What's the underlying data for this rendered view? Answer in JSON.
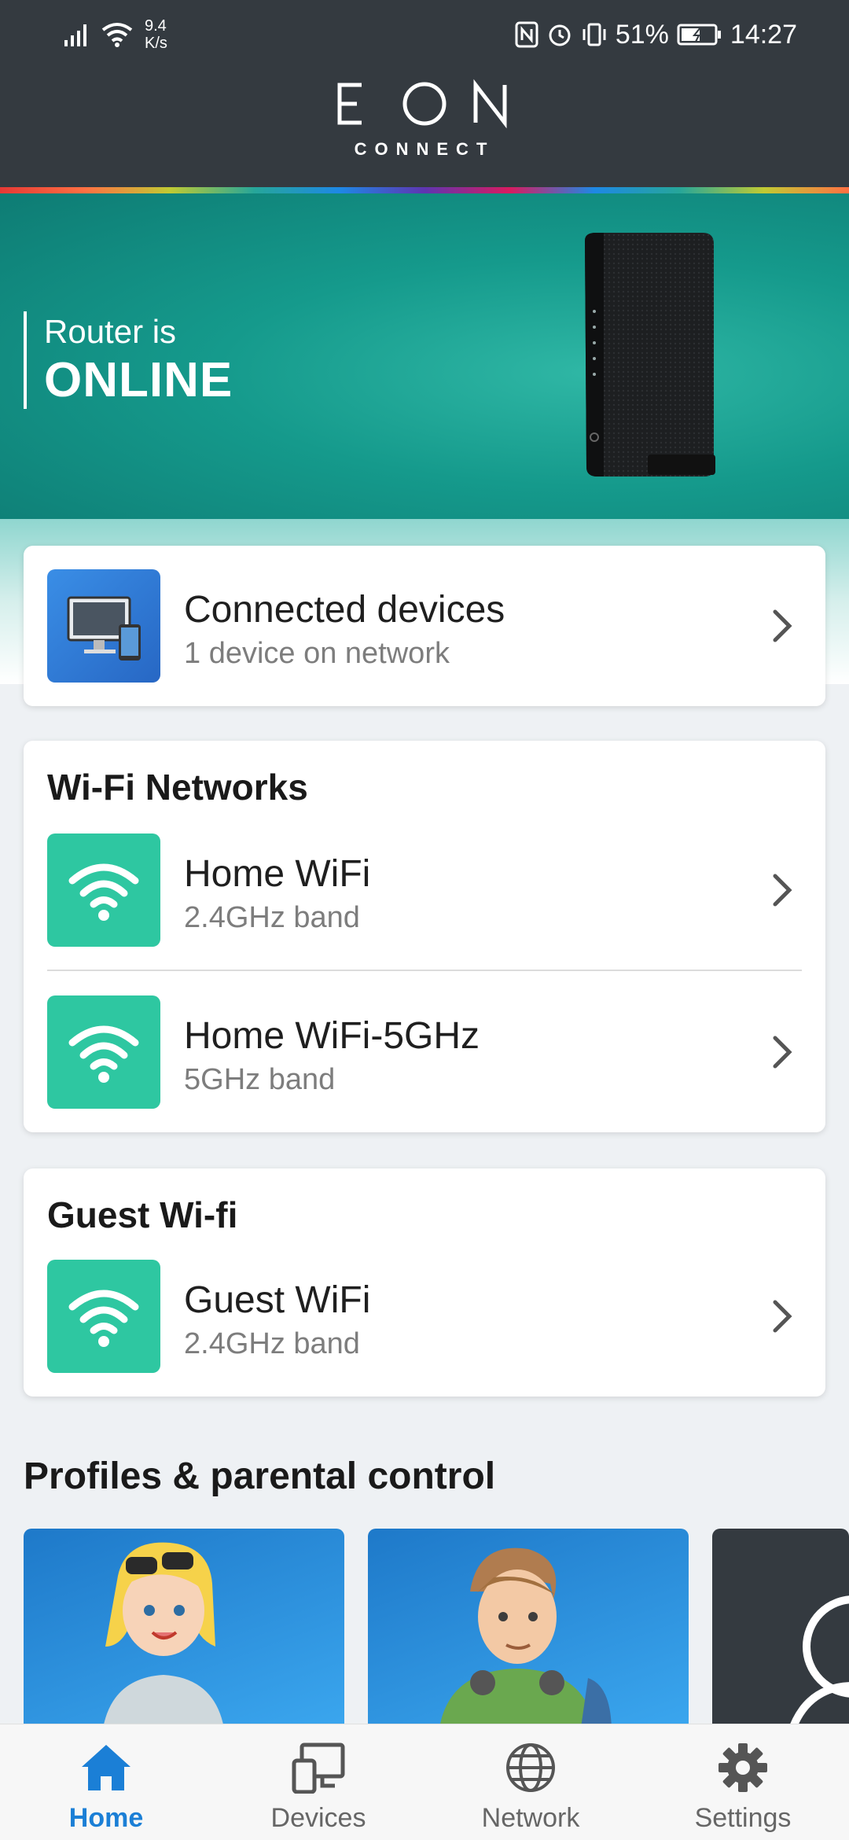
{
  "status_bar": {
    "network_speed_value": "9.4",
    "network_speed_unit": "K/s",
    "battery": "51%",
    "time": "14:27"
  },
  "header": {
    "logo_text": "EON",
    "logo_subtitle": "CONNECT"
  },
  "hero": {
    "line1": "Router is",
    "line2": "ONLINE"
  },
  "connected_devices": {
    "title": "Connected devices",
    "subtitle": "1 device on network"
  },
  "wifi_networks": {
    "heading": "Wi-Fi Networks",
    "items": [
      {
        "name": "Home WiFi",
        "band": "2.4GHz band"
      },
      {
        "name": "Home WiFi-5GHz",
        "band": "5GHz band"
      }
    ]
  },
  "guest_wifi": {
    "heading": "Guest Wi-fi",
    "items": [
      {
        "name": "Guest WiFi",
        "band": "2.4GHz band"
      }
    ]
  },
  "profiles": {
    "heading": "Profiles & parental control"
  },
  "bottom_nav": {
    "items": [
      {
        "label": "Home",
        "icon": "home-icon",
        "active": true
      },
      {
        "label": "Devices",
        "icon": "devices-icon",
        "active": false
      },
      {
        "label": "Network",
        "icon": "globe-icon",
        "active": false
      },
      {
        "label": "Settings",
        "icon": "gear-icon",
        "active": false
      }
    ]
  },
  "colors": {
    "header_bg": "#343a40",
    "hero_teal": "#159a8c",
    "wifi_tile": "#2ec7a1",
    "accent_blue": "#1b7fd6"
  }
}
